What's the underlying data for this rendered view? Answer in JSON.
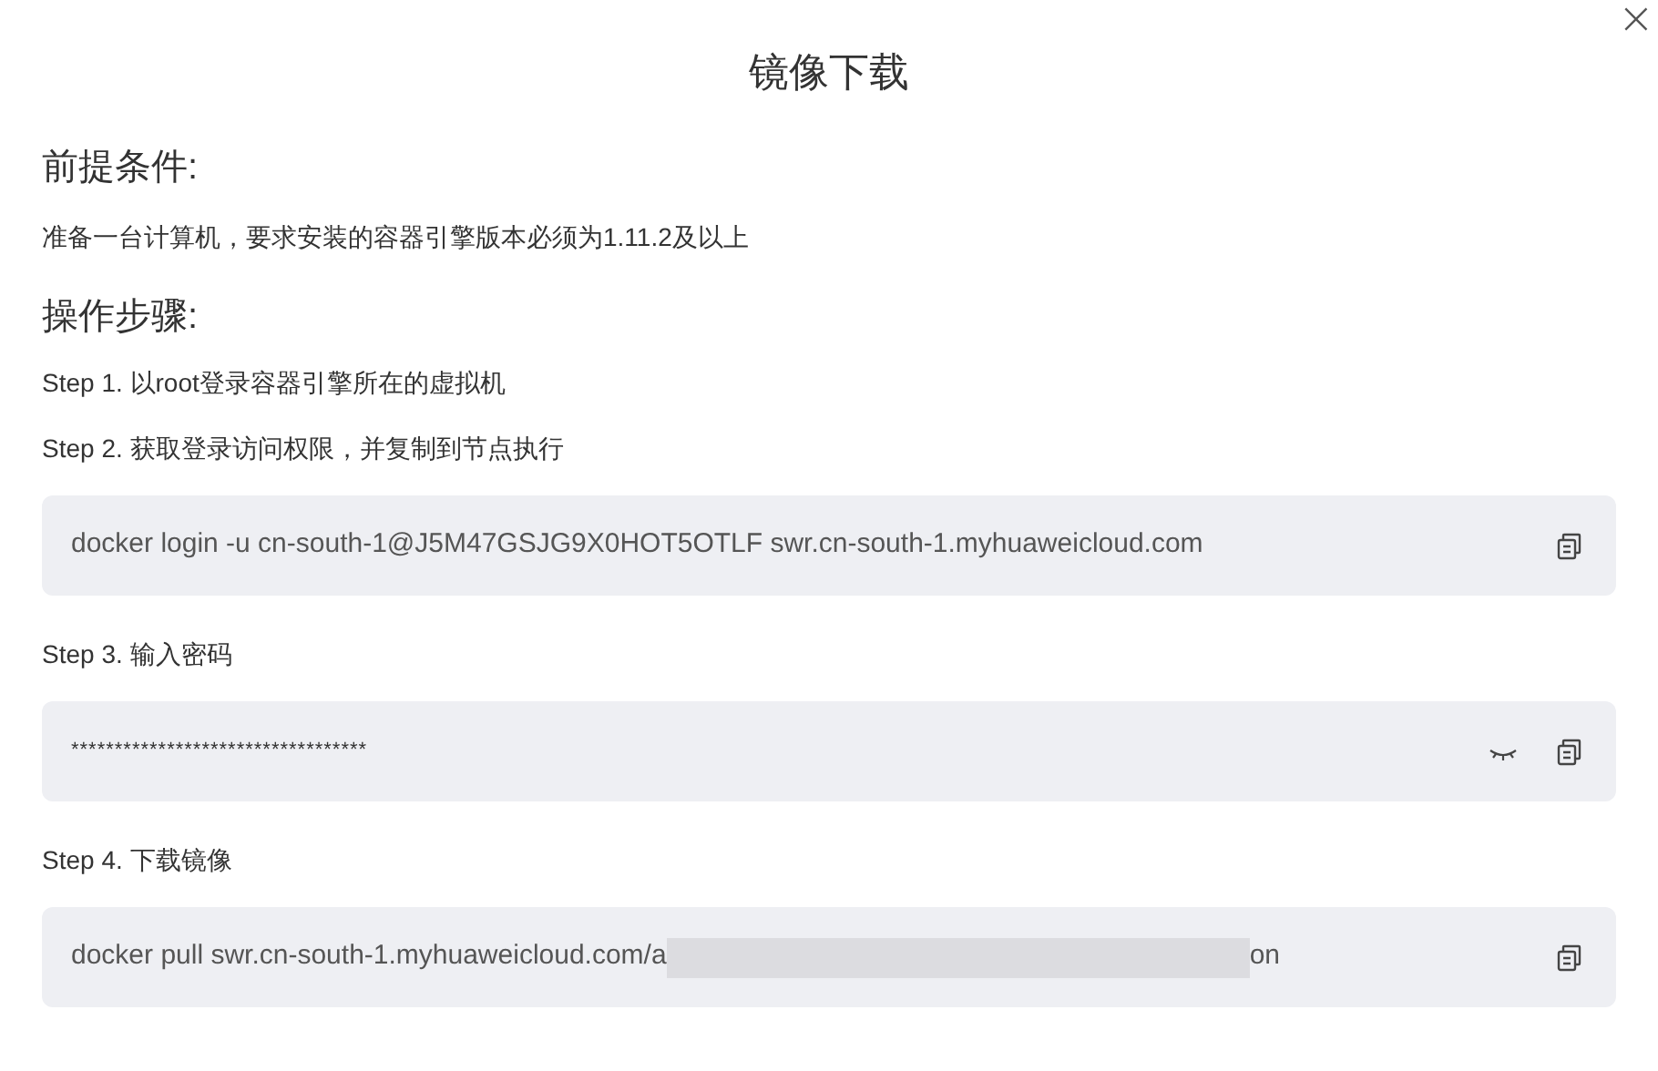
{
  "dialog": {
    "title": "镜像下载",
    "close": "×"
  },
  "sections": [
    {
      "heading": "前提条件:",
      "text": "准备一台计算机，要求安装的容器引擎版本必须为1.11.2及以上"
    },
    {
      "heading": "操作步骤:"
    }
  ],
  "steps": [
    {
      "label": "Step 1. 以root登录容器引擎所在的虚拟机"
    },
    {
      "label": "Step 2. 获取登录访问权限，并复制到节点执行",
      "kind": "command",
      "value": "docker login -u cn-south-1@J5M47GSJG9X0HOT5OTLF swr.cn-south-1.myhuaweicloud.com"
    },
    {
      "label": "Step 3. 输入密码",
      "kind": "password",
      "value": "**********************************",
      "revealed": false
    },
    {
      "label": "Step 4. 下载镜像",
      "kind": "redacted",
      "value": "docker pull swr.cn-south-1.myhuaweicloud.com/a",
      "value_end": "on"
    }
  ]
}
